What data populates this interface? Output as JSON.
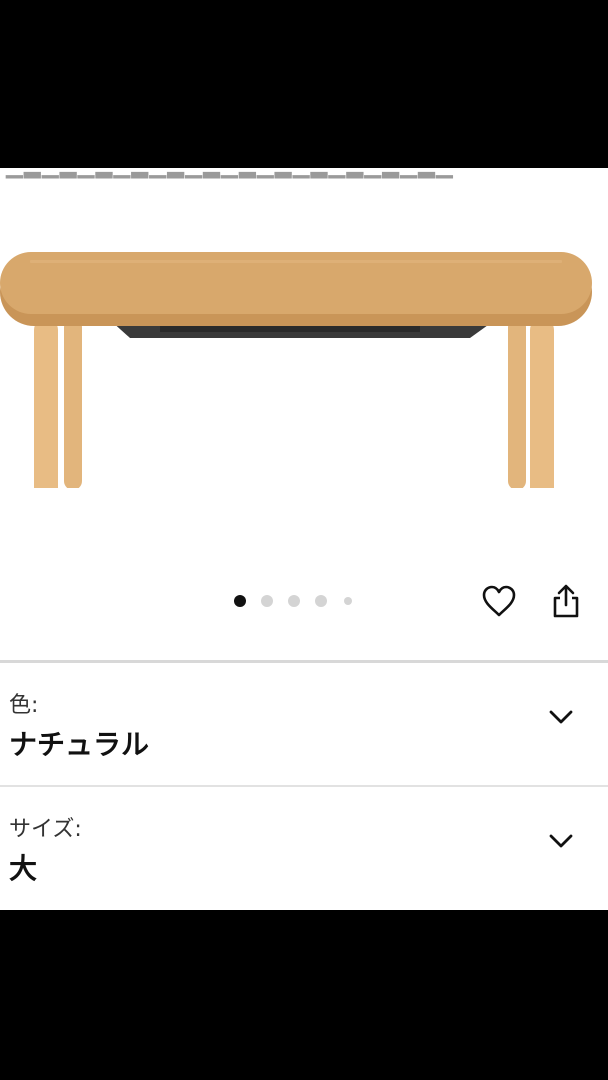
{
  "carousel": {
    "slides_total": 5,
    "active_index": 0
  },
  "options": [
    {
      "label": "色:",
      "value": "ナチュラル"
    },
    {
      "label": "サイズ:",
      "value": "大"
    }
  ],
  "icons": {
    "favorite": "heart-outline-icon",
    "share": "share-icon",
    "expand": "chevron-down-icon"
  },
  "colors": {
    "wood": "#D8A86C",
    "wood_edge": "#C99558",
    "dot_active": "#111111",
    "dot_inactive": "#D4D4D4"
  }
}
